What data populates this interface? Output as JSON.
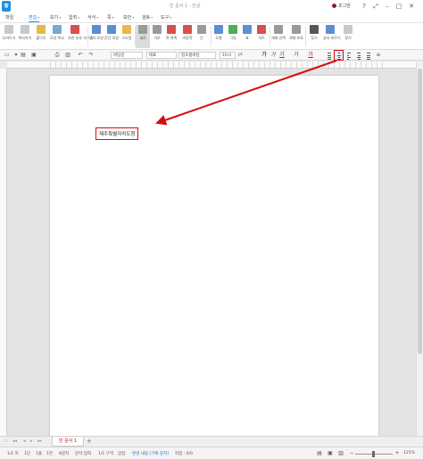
{
  "titlebar": {
    "doc_title": "빈 문서 1 - 한글",
    "user": "조그만"
  },
  "menu": [
    {
      "label": "파일",
      "active": false
    },
    {
      "label": "편집",
      "active": true
    },
    {
      "label": "보기",
      "active": false
    },
    {
      "label": "입력",
      "active": false
    },
    {
      "label": "서식",
      "active": false
    },
    {
      "label": "쪽",
      "active": false
    },
    {
      "label": "보안",
      "active": false
    },
    {
      "label": "검토",
      "active": false
    },
    {
      "label": "도구",
      "active": false
    }
  ],
  "ribbon": [
    {
      "label": "오려두기",
      "color": "#c9c9c9"
    },
    {
      "label": "복사하기",
      "color": "#c9c9c9"
    },
    {
      "label": "붙이기",
      "color": "#e8b94a"
    },
    {
      "label": "모양 복사",
      "color": "#7aa7d8"
    },
    {
      "label": "조판 부호 지우기",
      "color": "#d65050"
    },
    {
      "label": "글자 모양",
      "color": "#5b8fd1"
    },
    {
      "label": "문단 모양",
      "color": "#5b8fd1"
    },
    {
      "label": "스타일",
      "color": "#e8b94a"
    },
    {
      "label": "세로",
      "color": "#9a9a9a"
    },
    {
      "label": "가로",
      "color": "#9a9a9a"
    },
    {
      "label": "쪽 여백",
      "color": "#d65050"
    },
    {
      "label": "바탕쪽",
      "color": "#d65050"
    },
    {
      "label": "단",
      "color": "#9a9a9a"
    },
    {
      "label": "도형",
      "color": "#5b8fd1"
    },
    {
      "label": "그림",
      "color": "#4caf50"
    },
    {
      "label": "표",
      "color": "#5b8fd1"
    },
    {
      "label": "차트",
      "color": "#d65050"
    },
    {
      "label": "개체 선택",
      "color": "#9a9a9a"
    },
    {
      "label": "개체 보호",
      "color": "#9a9a9a"
    },
    {
      "label": "찾기",
      "color": "#555555"
    },
    {
      "label": "글자 바꾸기",
      "color": "#5b8fd1"
    },
    {
      "label": "찾기",
      "color": "#c9c9c9"
    }
  ],
  "format": {
    "style": "바탕글",
    "lang": "대표",
    "font": "함초롬바탕",
    "size": "10.0",
    "unit": "pt"
  },
  "document": {
    "text": "제주특별자치도청"
  },
  "tabs": {
    "doc_tab": "빈 문서 1",
    "add": "+"
  },
  "status": {
    "page": "1/1 쪽",
    "section": "1단",
    "line": "1줄",
    "col": "1칸",
    "chars": "8글자",
    "mode": "문자 입력",
    "area": "1/1 구역",
    "insert": "삽입",
    "track": "변경 내용 [기록 중지]",
    "net": "작업 : 0/0",
    "zoom": "125%"
  },
  "colors": {
    "accent": "#1f8fe0",
    "annotation": "#d10f0f"
  }
}
